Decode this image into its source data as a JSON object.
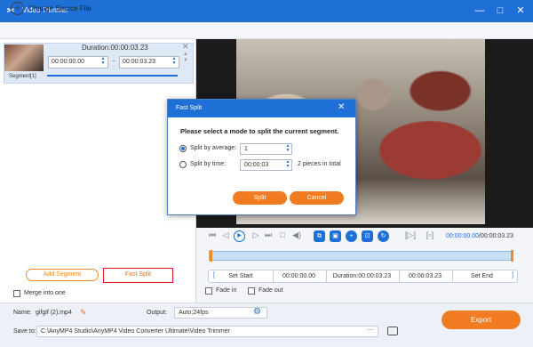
{
  "window": {
    "title": "Video Trimmer",
    "controls": [
      "—",
      "□",
      "✕"
    ]
  },
  "toolbar": {
    "change_source": "Change Source File"
  },
  "segment": {
    "duration": "Duration:00:00:03.23",
    "label": "Segment[1]",
    "start": "00:00:00.00",
    "separator": "~",
    "end": "00:00:03.23"
  },
  "left": {
    "add_segment": "Add Segment",
    "fast_split": "Fast Split",
    "merge_into_one": "Merge into one"
  },
  "player": {
    "time_current": "00:00:00.00",
    "time_total": "/00:00:03.23"
  },
  "setrow": {
    "set_start": "Set Start",
    "start_time": "00:00:00.00",
    "duration": "Duration:00:00:03.23",
    "end_time": "00:00:03.23",
    "set_end": "Set End"
  },
  "fades": {
    "fade_in": "Fade in",
    "fade_out": "Fade out"
  },
  "bottom": {
    "name_label": "Name:",
    "name_value": "gifgif (2).mp4",
    "output_label": "Output:",
    "output_value": "Auto;24fps",
    "save_label": "Save to:",
    "save_path": "C:\\AnyMP4 Studio\\AnyMP4 Video Converter Ultimate\\Video Trimmer",
    "dots": "···",
    "export": "Export"
  },
  "dialog": {
    "title": "Fast Split",
    "prompt": "Please select a mode to split the current segment.",
    "option_average": "Split by average:",
    "average_value": "1",
    "option_time": "Split by time:",
    "time_value": "00:00:03",
    "pieces_text": "2 pieces in total",
    "split_button": "Split",
    "cancel_button": "Cancel",
    "selected_mode": "average"
  },
  "colors": {
    "accent": "#1e6fd6",
    "orange": "#f07b20",
    "highlight": "#d81d2a"
  }
}
